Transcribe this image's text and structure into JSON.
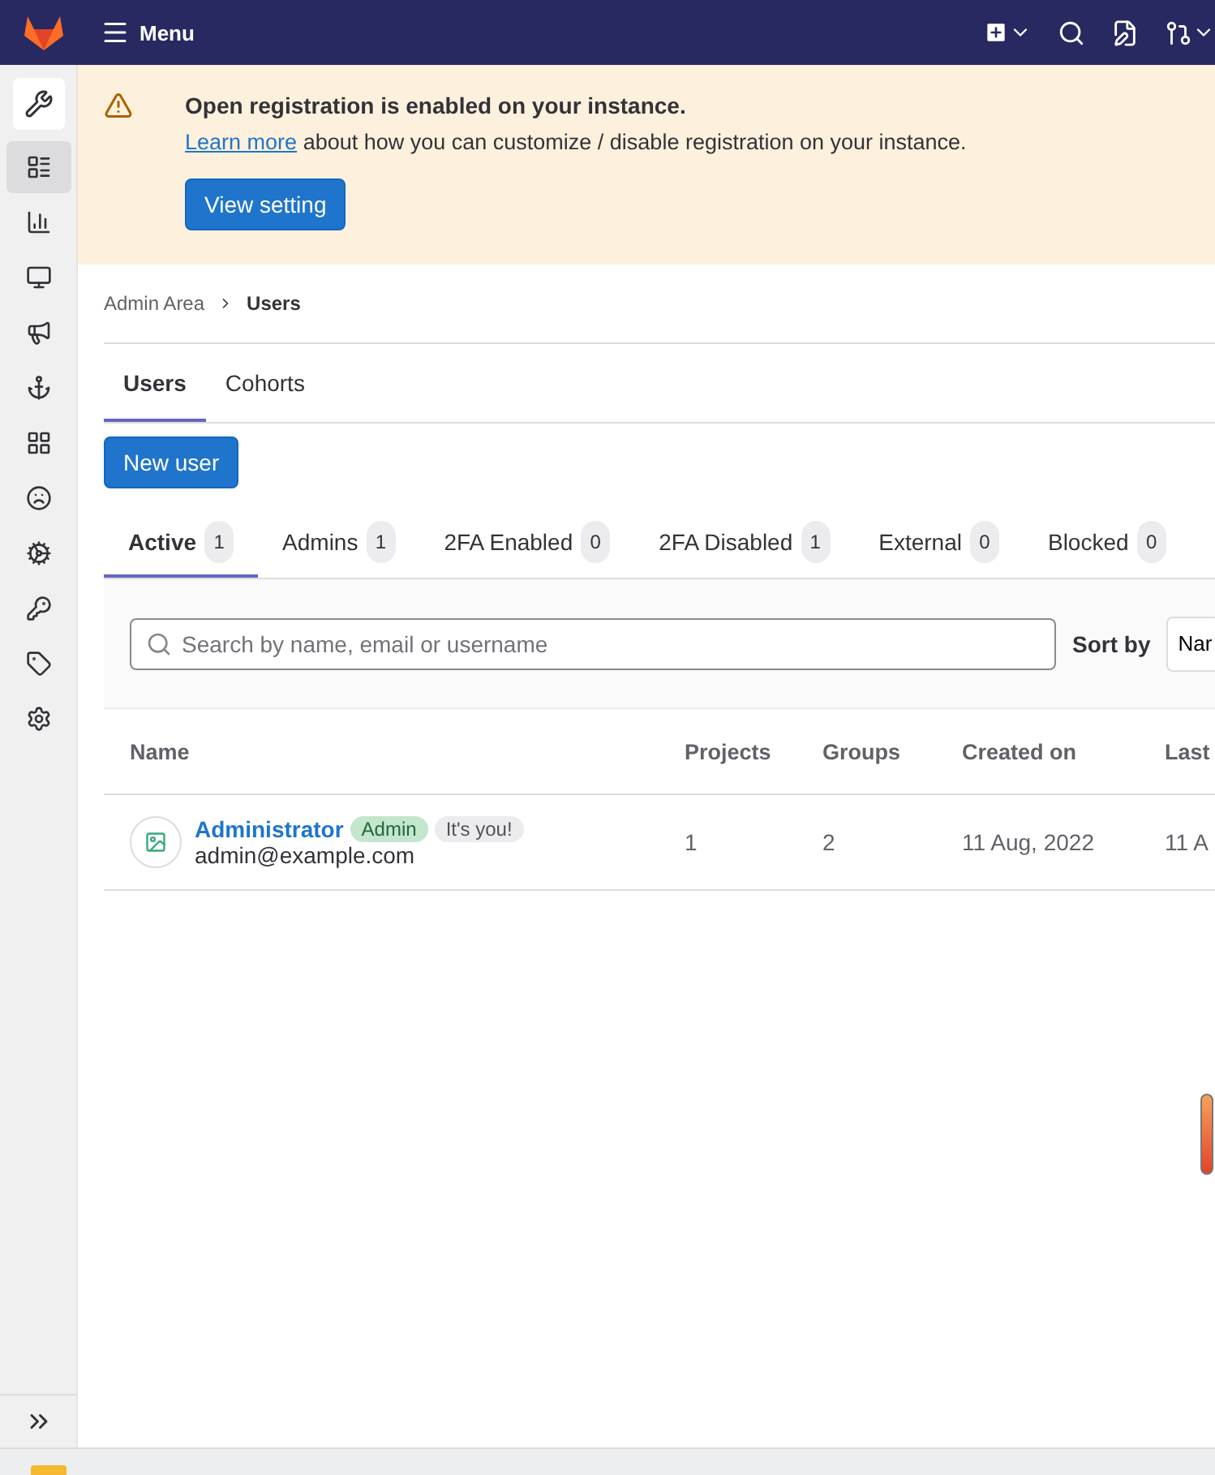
{
  "top_bar": {
    "menu_label": "Menu"
  },
  "sidebar": {
    "items": [
      {
        "selected": false
      },
      {
        "selected": true
      },
      {
        "selected": false
      },
      {
        "selected": false
      },
      {
        "selected": false
      },
      {
        "selected": false
      },
      {
        "selected": false
      },
      {
        "selected": false
      },
      {
        "selected": false
      },
      {
        "selected": false
      },
      {
        "selected": false
      },
      {
        "selected": false
      }
    ]
  },
  "banner": {
    "title": "Open registration is enabled on your instance.",
    "link": "Learn more",
    "text": "about how you can customize / disable registration on your instance.",
    "button": "View setting"
  },
  "breadcrumb": [
    "Admin Area",
    "Users"
  ],
  "tabs": [
    {
      "label": "Users",
      "selected": true
    },
    {
      "label": "Cohorts",
      "selected": false
    }
  ],
  "new_user_button": "New user",
  "filter_tabs": [
    {
      "label": "Active",
      "count": "1",
      "selected": true
    },
    {
      "label": "Admins",
      "count": "1",
      "selected": false
    },
    {
      "label": "2FA Enabled",
      "count": "0",
      "selected": false
    },
    {
      "label": "2FA Disabled",
      "count": "1",
      "selected": false
    },
    {
      "label": "External",
      "count": "0",
      "selected": false
    },
    {
      "label": "Blocked",
      "count": "0",
      "selected": false
    }
  ],
  "search": {
    "placeholder": "Search by name, email or username",
    "sort_label": "Sort by",
    "sort_value": "Nar"
  },
  "table": {
    "columns": [
      "Name",
      "Projects",
      "Groups",
      "Created on",
      "Last"
    ],
    "rows": [
      {
        "name": "Administrator",
        "badges": [
          {
            "label": "Admin",
            "color": "#c3e6cd"
          },
          {
            "label": "It's you!",
            "color": "#ececef"
          }
        ],
        "email": "admin@example.com",
        "projects": "1",
        "groups": "2",
        "created": "11 Aug, 2022",
        "last": "11 A"
      }
    ]
  }
}
